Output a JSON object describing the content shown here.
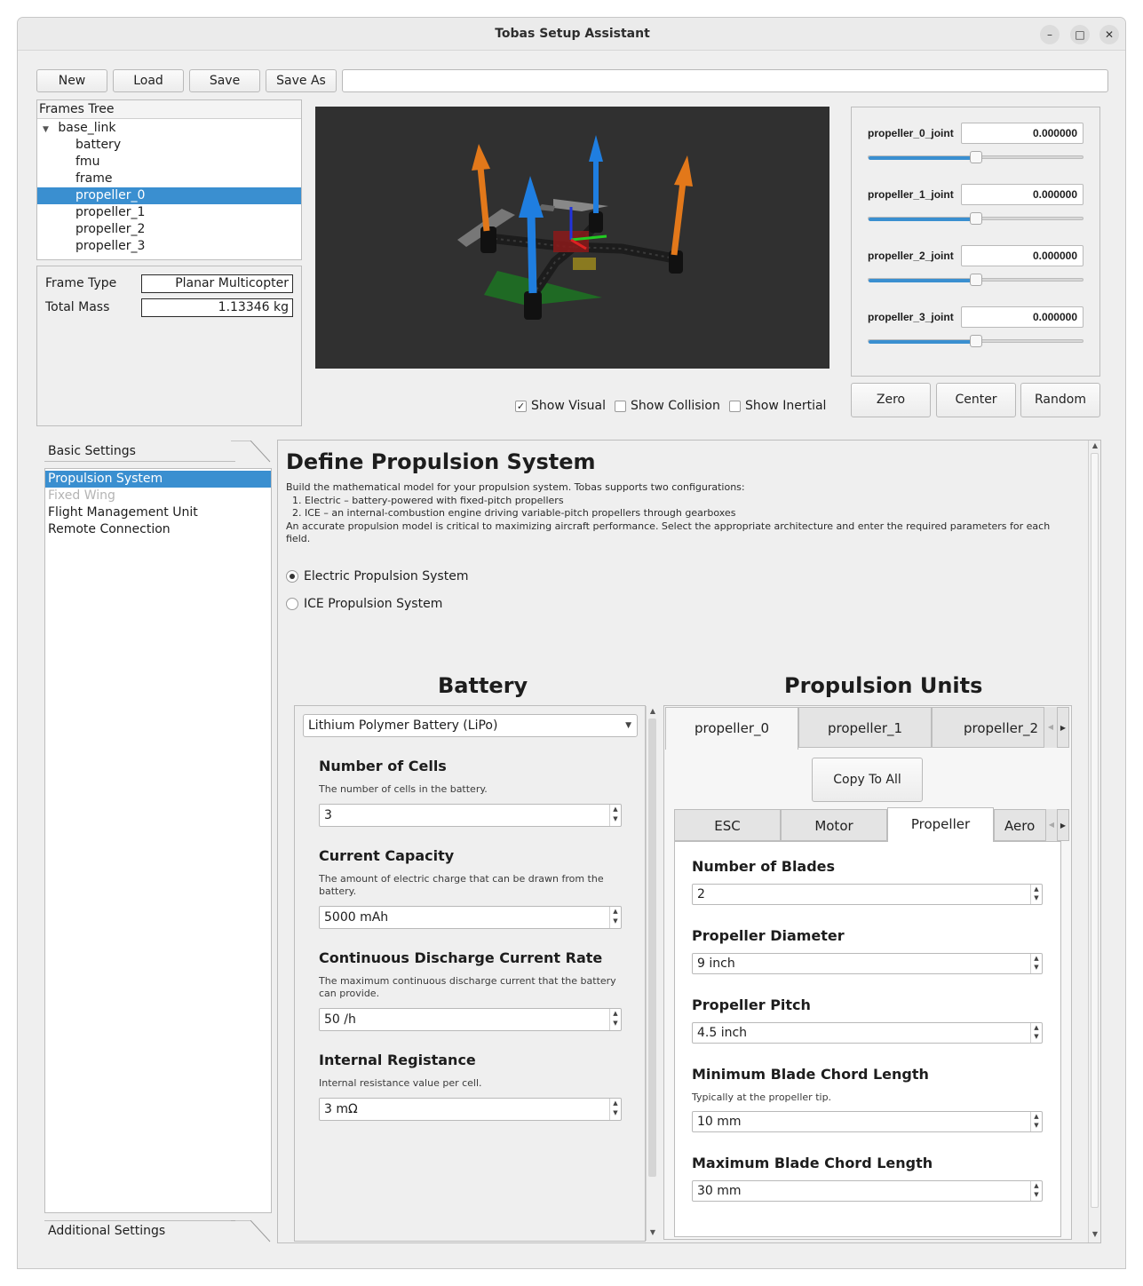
{
  "window": {
    "title": "Tobas Setup Assistant",
    "minimize_icon": "minimize-icon",
    "maximize_icon": "maximize-icon",
    "close_icon": "close-icon"
  },
  "toolbar": {
    "new_label": "New",
    "load_label": "Load",
    "save_label": "Save",
    "save_as_label": "Save As",
    "path_value": ""
  },
  "frames_tree": {
    "header": "Frames Tree",
    "root": "base_link",
    "children": [
      "battery",
      "fmu",
      "frame",
      "propeller_0",
      "propeller_1",
      "propeller_2",
      "propeller_3"
    ],
    "selected": "propeller_0"
  },
  "frame_info": {
    "type_label": "Frame Type",
    "type_value": "Planar Multicopter",
    "mass_label": "Total Mass",
    "mass_value": "1.13346 kg"
  },
  "viewer": {
    "show_visual_label": "Show Visual",
    "show_visual_checked": true,
    "show_collision_label": "Show Collision",
    "show_collision_checked": false,
    "show_inertial_label": "Show Inertial",
    "show_inertial_checked": false
  },
  "joints": [
    {
      "name": "propeller_0_joint",
      "value": "0.000000",
      "slider": 0.5
    },
    {
      "name": "propeller_1_joint",
      "value": "0.000000",
      "slider": 0.5
    },
    {
      "name": "propeller_2_joint",
      "value": "0.000000",
      "slider": 0.5
    },
    {
      "name": "propeller_3_joint",
      "value": "0.000000",
      "slider": 0.5
    }
  ],
  "joint_buttons": {
    "zero": "Zero",
    "center": "Center",
    "random": "Random"
  },
  "sidebar": {
    "basic_tab": "Basic Settings",
    "items": [
      {
        "label": "Propulsion System",
        "state": "selected"
      },
      {
        "label": "Fixed Wing",
        "state": "disabled"
      },
      {
        "label": "Flight Management Unit",
        "state": "normal"
      },
      {
        "label": "Remote Connection",
        "state": "normal"
      }
    ],
    "additional_tab": "Additional Settings"
  },
  "main": {
    "title": "Define Propulsion System",
    "description": [
      "Build the mathematical model for your propulsion system. Tobas supports two configurations:",
      "  1. Electric – battery-powered with fixed-pitch propellers",
      "  2. ICE – an internal-combustion engine driving variable-pitch propellers through gearboxes",
      "An accurate propulsion model is critical to maximizing aircraft performance. Select the appropriate architecture and enter the required parameters for each field."
    ],
    "radio_electric": "Electric Propulsion System",
    "radio_ice": "ICE Propulsion System",
    "selected_system": "Electric Propulsion System"
  },
  "battery": {
    "heading": "Battery",
    "type_value": "Lithium Polymer Battery (LiPo)",
    "fields": [
      {
        "title": "Number of Cells",
        "desc": [
          "The number of cells in the battery."
        ],
        "value": "3"
      },
      {
        "title": "Current Capacity",
        "desc": [
          "The amount of electric charge that can be drawn from the",
          "battery."
        ],
        "value": "5000 mAh"
      },
      {
        "title": "Continuous Discharge Current Rate",
        "desc": [
          "The maximum continuous discharge current that the battery",
          "can provide."
        ],
        "value": "50 /h"
      },
      {
        "title": "Internal Registance",
        "desc": [
          "Internal resistance value per cell."
        ],
        "value": "3 mΩ"
      }
    ]
  },
  "propulsion": {
    "heading": "Propulsion Units",
    "unit_tabs": [
      "propeller_0",
      "propeller_1",
      "propeller_2"
    ],
    "active_unit": "propeller_0",
    "copy_label": "Copy To All",
    "sub_tabs": [
      "ESC",
      "Motor",
      "Propeller",
      "Aero"
    ],
    "active_sub_tab": "Propeller",
    "fields": [
      {
        "title": "Number of Blades",
        "desc": "",
        "value": "2"
      },
      {
        "title": "Propeller Diameter",
        "desc": "",
        "value": "9 inch"
      },
      {
        "title": "Propeller Pitch",
        "desc": "",
        "value": "4.5 inch"
      },
      {
        "title": "Minimum Blade Chord Length",
        "desc": "Typically at the propeller tip.",
        "value": "10 mm"
      },
      {
        "title": "Maximum Blade Chord Length",
        "desc": "",
        "value": "30 mm"
      }
    ]
  }
}
